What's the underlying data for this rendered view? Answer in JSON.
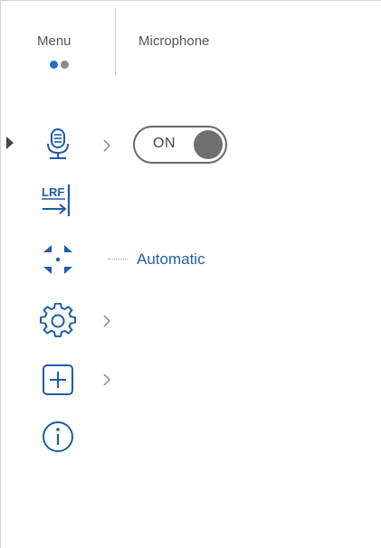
{
  "header": {
    "menu_label": "Menu",
    "section_label": "Microphone",
    "page_dots": [
      {
        "color": "#1f6fd1",
        "active": true
      },
      {
        "color": "#8a8a8a",
        "active": false
      }
    ]
  },
  "colors": {
    "accent": "#1f5fa8",
    "icon_blue": "#1d5ca8",
    "toggle_grey": "#6f6f6f"
  },
  "menu_items": [
    {
      "icon": "microphone-icon",
      "has_submenu": true,
      "selected": true
    },
    {
      "icon": "lrf-icon",
      "has_submenu": false,
      "lrf_text": "LRF"
    },
    {
      "icon": "focus-mode-icon",
      "has_submenu": false,
      "value": "Automatic"
    },
    {
      "icon": "gear-icon",
      "has_submenu": true
    },
    {
      "icon": "plus-box-icon",
      "has_submenu": true
    },
    {
      "icon": "info-icon",
      "has_submenu": false
    }
  ],
  "microphone_toggle": {
    "label": "ON",
    "state": "on"
  }
}
